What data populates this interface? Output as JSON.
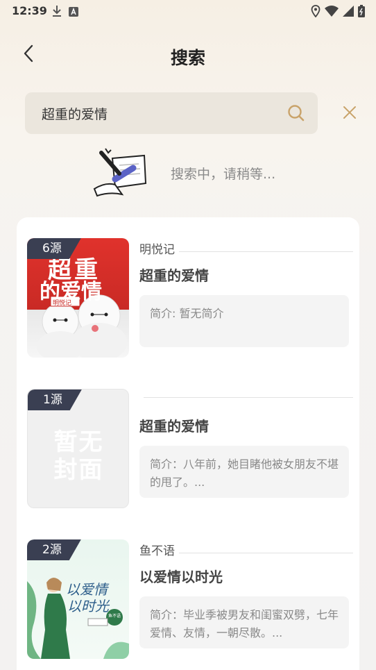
{
  "status_bar": {
    "time": "12:39",
    "left_icons": [
      "download-icon",
      "a-letter-icon"
    ],
    "right_icons": [
      "location-icon",
      "wifi-icon",
      "signal-icon",
      "battery-icon"
    ]
  },
  "header": {
    "title": "搜索",
    "back_icon": "chevron-left-icon"
  },
  "search": {
    "value": "超重的爱情",
    "search_icon": "search-icon",
    "clear_icon": "close-icon"
  },
  "status_message": "搜索中，请稍等...",
  "results": [
    {
      "sources": "6源",
      "author": "明悦记",
      "title": "超重的爱情",
      "intro": "简介: 暂无简介",
      "cover_text": [
        "超重",
        "的爱情",
        "明悦记"
      ]
    },
    {
      "sources": "1源",
      "author": "",
      "title": "超重的爱情",
      "intro": "简介：八年前，她目睹他被女朋友不堪的甩了。...",
      "cover_text": [
        "暂无",
        "封面"
      ]
    },
    {
      "sources": "2源",
      "author": "鱼不语",
      "title": "以爱情以时光",
      "intro": "简介：毕业季被男友和闺蜜双劈，七年爱情、友情，一朝尽散。...",
      "cover_text": [
        "以爱情",
        "以时光",
        "鱼不语"
      ]
    }
  ],
  "colors": {
    "accent": "#c9a36a",
    "badge": "#3a3f52",
    "card": "#ffffff"
  }
}
